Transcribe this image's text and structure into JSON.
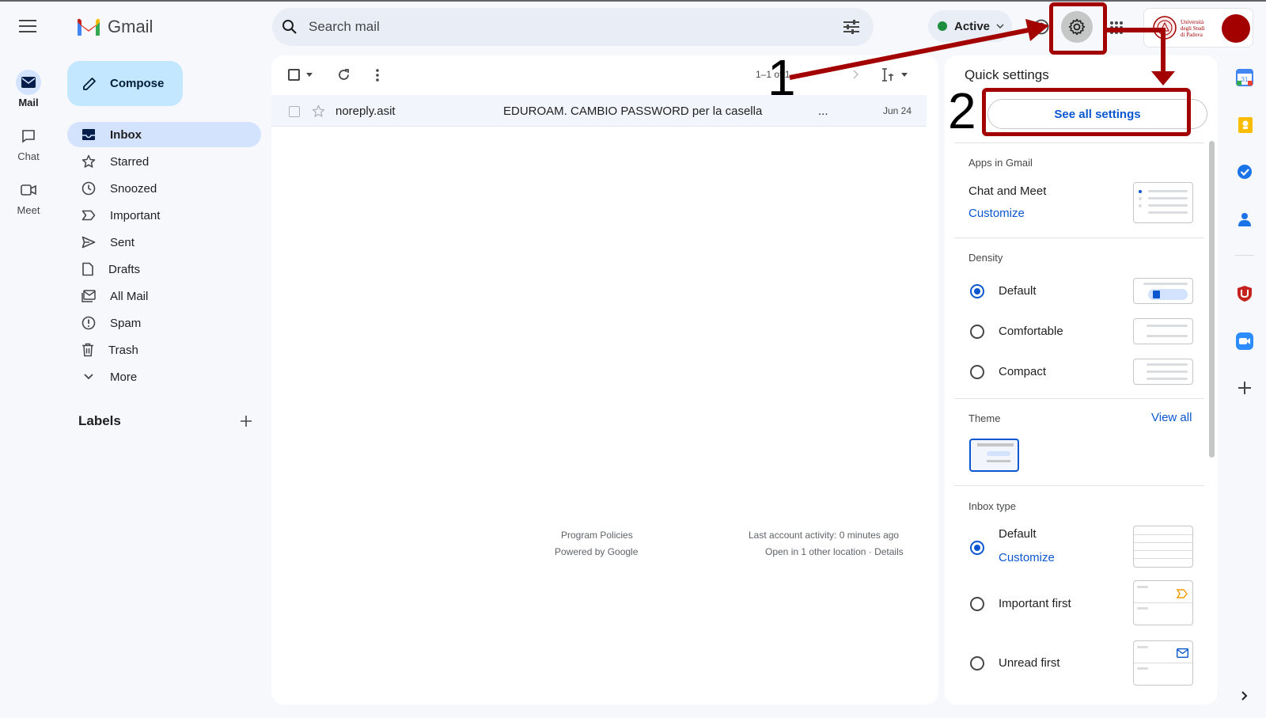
{
  "app": {
    "title": "Gmail"
  },
  "rail": [
    {
      "label": "Mail",
      "icon": "mail-icon",
      "active": true
    },
    {
      "label": "Chat",
      "icon": "chat-icon",
      "active": false
    },
    {
      "label": "Meet",
      "icon": "meet-icon",
      "active": false
    }
  ],
  "search": {
    "placeholder": "Search mail"
  },
  "status": {
    "label": "Active",
    "color": "#1e8e3e"
  },
  "compose": {
    "label": "Compose"
  },
  "nav": [
    {
      "label": "Inbox",
      "icon": "inbox-icon",
      "active": true
    },
    {
      "label": "Starred",
      "icon": "star-icon"
    },
    {
      "label": "Snoozed",
      "icon": "clock-icon"
    },
    {
      "label": "Important",
      "icon": "important-icon"
    },
    {
      "label": "Sent",
      "icon": "send-icon"
    },
    {
      "label": "Drafts",
      "icon": "draft-icon"
    },
    {
      "label": "All Mail",
      "icon": "all-mail-icon"
    },
    {
      "label": "Spam",
      "icon": "spam-icon"
    },
    {
      "label": "Trash",
      "icon": "trash-icon"
    },
    {
      "label": "More",
      "icon": "chevron-down-icon"
    }
  ],
  "labels": {
    "title": "Labels"
  },
  "toolbar": {
    "pagination": "1–1 of 1"
  },
  "emails": [
    {
      "sender": "noreply.asit",
      "subject": "EDUROAM. CAMBIO PASSWORD per la casella",
      "snippet": "...",
      "date": "Jun 24"
    }
  ],
  "footer": {
    "policies": "Program Policies",
    "powered": "Powered by Google",
    "activity": "Last account activity: 0 minutes ago",
    "location": "Open in 1 other location · Details"
  },
  "quick_settings": {
    "title": "Quick settings",
    "see_all": "See all settings",
    "apps_title": "Apps in Gmail",
    "apps_item": "Chat and Meet",
    "apps_customize": "Customize",
    "density_title": "Density",
    "density_options": [
      {
        "label": "Default",
        "selected": true
      },
      {
        "label": "Comfortable",
        "selected": false
      },
      {
        "label": "Compact",
        "selected": false
      }
    ],
    "theme_title": "Theme",
    "theme_view_all": "View all",
    "inbox_title": "Inbox type",
    "inbox_options": [
      {
        "label": "Default",
        "selected": true,
        "sub": "Customize"
      },
      {
        "label": "Important first",
        "selected": false
      },
      {
        "label": "Unread first",
        "selected": false
      }
    ]
  },
  "org_logo": {
    "lines": [
      "Università",
      "degli Studi",
      "di Padova"
    ]
  },
  "annotations": {
    "step1": "1",
    "step2": "2",
    "color": "#a30000"
  },
  "colors": {
    "accent": "#0b57d0",
    "nav_active": "#d3e3fd",
    "compose": "#c2e7ff",
    "annotation": "#a30000"
  }
}
